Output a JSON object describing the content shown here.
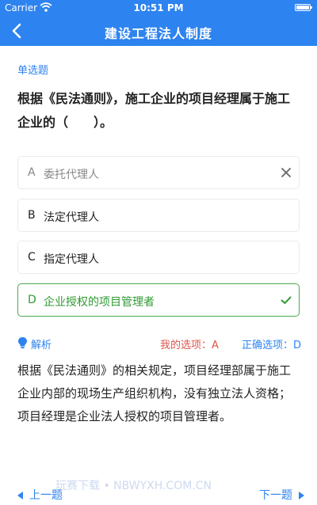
{
  "status_bar": {
    "carrier": "Carrier",
    "time": "10:51 PM"
  },
  "nav": {
    "title": "建设工程法人制度"
  },
  "question": {
    "type": "单选题",
    "text": "根据《民法通则》，施工企业的项目经理属于施工企业的（　　）。",
    "options": [
      {
        "letter": "A",
        "text": "委托代理人",
        "state": "wrong"
      },
      {
        "letter": "B",
        "text": "法定代理人",
        "state": "normal"
      },
      {
        "letter": "C",
        "text": "指定代理人",
        "state": "normal"
      },
      {
        "letter": "D",
        "text": "企业授权的项目管理者",
        "state": "correct"
      }
    ]
  },
  "analysis": {
    "label": "解析",
    "my_choice": "我的选项：A",
    "correct_choice": "正确选项：D",
    "text": "根据《民法通则》的相关规定，项目经理部属于施工企业内部的现场生产组织机构，没有独立法人资格；项目经理是企业法人授权的项目管理者。"
  },
  "footer": {
    "prev": "上一题",
    "next": "下一题",
    "watermark": "玩赛下载 • NBWYXH.COM.CN"
  },
  "colors": {
    "primary": "#2d83f0",
    "correct": "#2f9a33",
    "wrong": "#e0544b"
  },
  "icons": [
    "wifi-icon",
    "battery-icon",
    "back-chevron-icon",
    "close-icon",
    "check-icon",
    "lightbulb-icon"
  ]
}
